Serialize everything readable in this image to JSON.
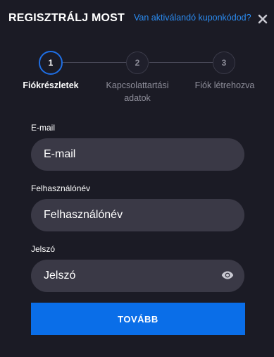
{
  "header": {
    "title": "REGISZTRÁLJ MOST",
    "coupon_link": "Van aktiválandó kuponkódod?",
    "close_icon": "close-icon"
  },
  "steps": [
    {
      "number": "1",
      "label": "Fiókrészletek",
      "active": true
    },
    {
      "number": "2",
      "label_line1": "Kapcsolattartási",
      "label_line2": "adatok",
      "active": false
    },
    {
      "number": "3",
      "label": "Fiók létrehozva",
      "active": false
    }
  ],
  "form": {
    "email": {
      "label": "E-mail",
      "placeholder": "E-mail"
    },
    "username": {
      "label": "Felhasználónév",
      "placeholder": "Felhasználónév"
    },
    "password": {
      "label": "Jelszó",
      "placeholder": "Jelszó",
      "toggle_icon": "eye-icon"
    },
    "submit_label": "TOVÁBB"
  },
  "colors": {
    "background": "#1b1b25",
    "accent": "#0a6ee8",
    "link": "#2b8cf2",
    "input_bg": "#3a3946"
  }
}
